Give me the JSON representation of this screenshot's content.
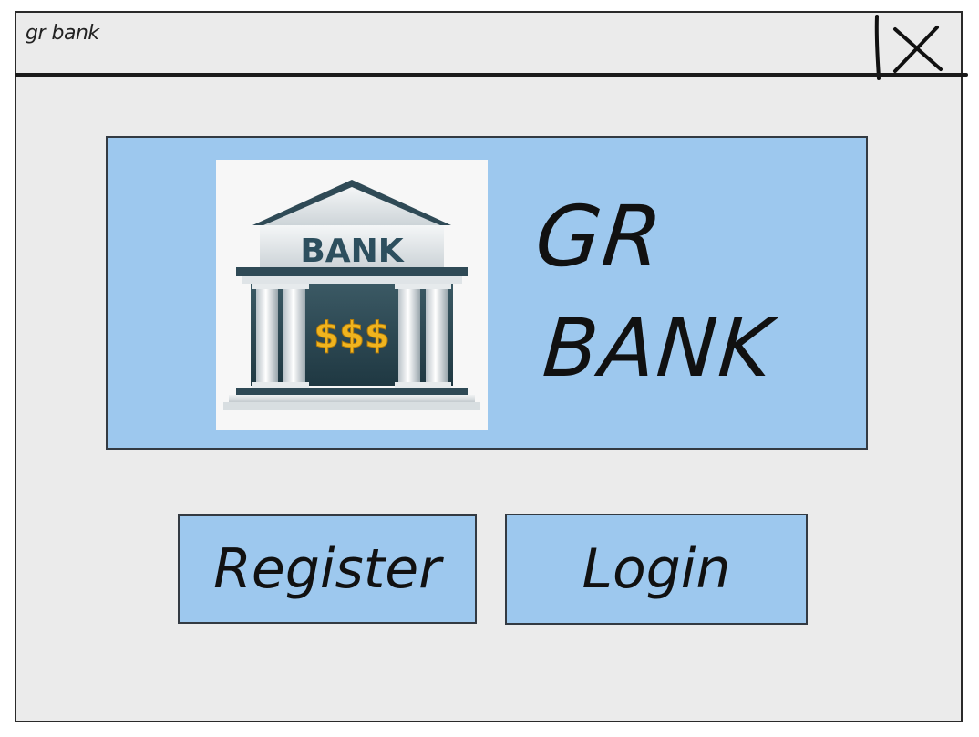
{
  "window": {
    "title": "gr bank",
    "close_icon": "close-icon"
  },
  "banner": {
    "logo": {
      "icon": "bank-building-icon",
      "sign_text": "BANK",
      "money_text": "$$$",
      "colors": {
        "roof": "#2f4a56",
        "sign": "#2d4f5e",
        "money": "#f0b41e",
        "columns": "#e8ecef"
      }
    },
    "brand_line_1": "GR",
    "brand_line_2": "BANK"
  },
  "actions": {
    "register_label": "Register",
    "login_label": "Login"
  },
  "colors": {
    "window_bg": "#ebebeb",
    "accent_blue": "#9dc8ee",
    "border": "#333a42"
  }
}
